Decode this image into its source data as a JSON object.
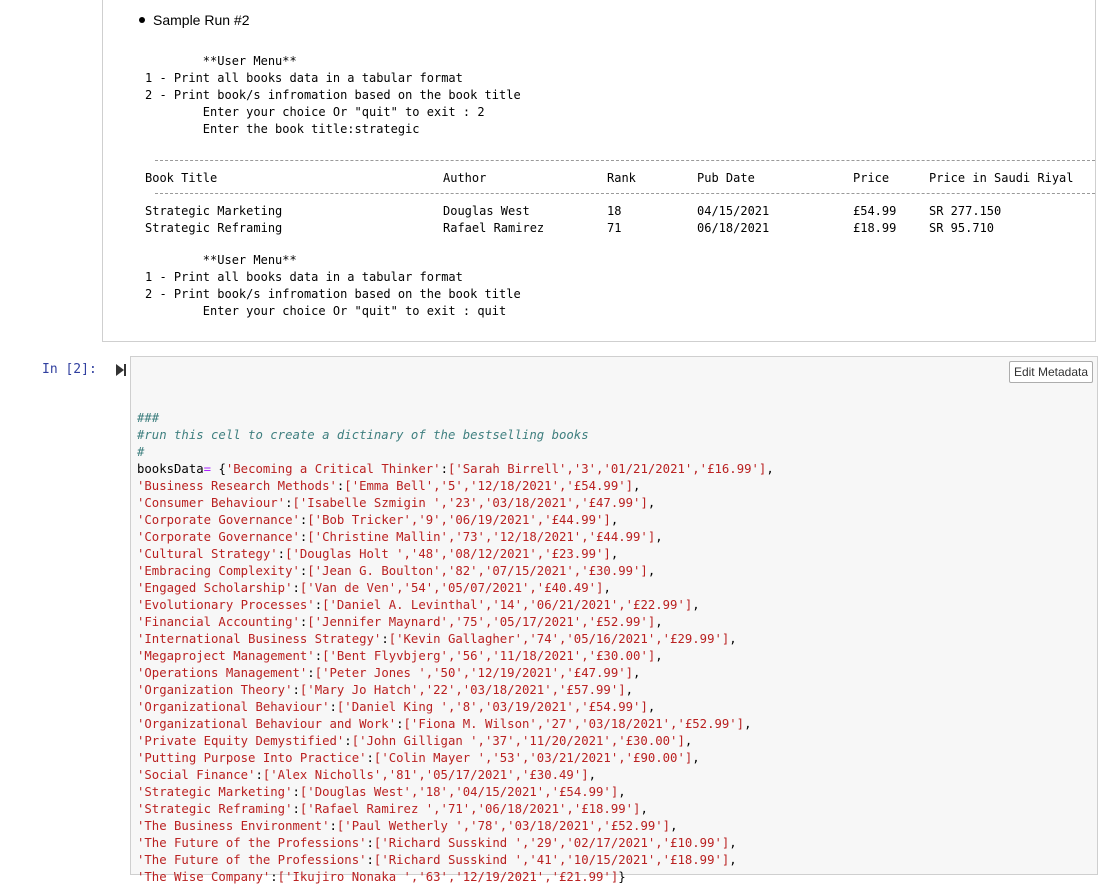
{
  "markdown": {
    "bullet": "Sample Run #2",
    "menu1": [
      "        **User Menu**",
      "1 - Print all books data in a tabular format",
      "2 - Print book/s infromation based on the book title",
      "        Enter your choice Or \"quit\" to exit : 2",
      "        Enter the book title:strategic"
    ],
    "table": {
      "headers": [
        "Book Title",
        "Author",
        "Rank",
        "Pub Date",
        "Price",
        "Price in Saudi Riyal"
      ],
      "rows": [
        [
          "Strategic Marketing",
          "Douglas West",
          "18",
          "04/15/2021",
          "£54.99",
          "SR 277.150"
        ],
        [
          "Strategic Reframing",
          "Rafael Ramirez",
          "71",
          "06/18/2021",
          "£18.99",
          "SR 95.710"
        ]
      ]
    },
    "menu2": [
      "        **User Menu**",
      "1 - Print all books data in a tabular format",
      "2 - Print book/s infromation based on the book title",
      "        Enter your choice Or \"quit\" to exit : quit"
    ]
  },
  "code_cell": {
    "prompt": "In [2]:",
    "edit_metadata_label": "Edit Metadata",
    "comments": [
      "###",
      "#run this cell to create a dictinary of the bestselling books",
      "#"
    ],
    "var_name": "booksData",
    "op": "=",
    "books": [
      {
        "title": "'Becoming a Critical Thinker'",
        "vals": "['Sarah Birrell','3','01/21/2021','£16.99']"
      },
      {
        "title": "'Business Research Methods'",
        "vals": "['Emma Bell','5','12/18/2021','£54.99']"
      },
      {
        "title": "'Consumer Behaviour'",
        "vals": "['Isabelle Szmigin ','23','03/18/2021','£47.99']"
      },
      {
        "title": "'Corporate Governance'",
        "vals": "['Bob Tricker','9','06/19/2021','£44.99']"
      },
      {
        "title": "'Corporate Governance'",
        "vals": "['Christine Mallin','73','12/18/2021','£44.99']"
      },
      {
        "title": "'Cultural Strategy'",
        "vals": "['Douglas Holt ','48','08/12/2021','£23.99']"
      },
      {
        "title": "'Embracing Complexity'",
        "vals": "['Jean G. Boulton','82','07/15/2021','£30.99']"
      },
      {
        "title": "'Engaged Scholarship'",
        "vals": "['Van de Ven','54','05/07/2021','£40.49']"
      },
      {
        "title": "'Evolutionary Processes'",
        "vals": "['Daniel A. Levinthal','14','06/21/2021','£22.99']"
      },
      {
        "title": "'Financial Accounting'",
        "vals": "['Jennifer Maynard','75','05/17/2021','£52.99']"
      },
      {
        "title": "'International Business Strategy'",
        "vals": "['Kevin Gallagher','74','05/16/2021','£29.99']"
      },
      {
        "title": "'Megaproject Management'",
        "vals": "['Bent Flyvbjerg','56','11/18/2021','£30.00']"
      },
      {
        "title": "'Operations Management'",
        "vals": "['Peter Jones ','50','12/19/2021','£47.99']"
      },
      {
        "title": "'Organization Theory'",
        "vals": "['Mary Jo Hatch','22','03/18/2021','£57.99']"
      },
      {
        "title": "'Organizational Behaviour'",
        "vals": "['Daniel King ','8','03/19/2021','£54.99']"
      },
      {
        "title": "'Organizational Behaviour and Work'",
        "vals": "['Fiona M. Wilson','27','03/18/2021','£52.99']"
      },
      {
        "title": "'Private Equity Demystified'",
        "vals": "['John Gilligan ','37','11/20/2021','£30.00']"
      },
      {
        "title": "'Putting Purpose Into Practice'",
        "vals": "['Colin Mayer ','53','03/21/2021','£90.00']"
      },
      {
        "title": "'Social Finance'",
        "vals": "['Alex Nicholls','81','05/17/2021','£30.49']"
      },
      {
        "title": "'Strategic Marketing'",
        "vals": "['Douglas West','18','04/15/2021','£54.99']"
      },
      {
        "title": "'Strategic Reframing'",
        "vals": "['Rafael Ramirez ','71','06/18/2021','£18.99']"
      },
      {
        "title": "'The Business Environment'",
        "vals": "['Paul Wetherly ','78','03/18/2021','£52.99']"
      },
      {
        "title": "'The Future of the Professions'",
        "vals": "['Richard Susskind ','29','02/17/2021','£10.99']"
      },
      {
        "title": "'The Future of the Professions'",
        "vals": "['Richard Susskind ','41','10/15/2021','£18.99']"
      },
      {
        "title": "'The Wise Company'",
        "vals": "['Ikujiro Nonaka ','63','12/19/2021','£21.99']"
      }
    ]
  }
}
